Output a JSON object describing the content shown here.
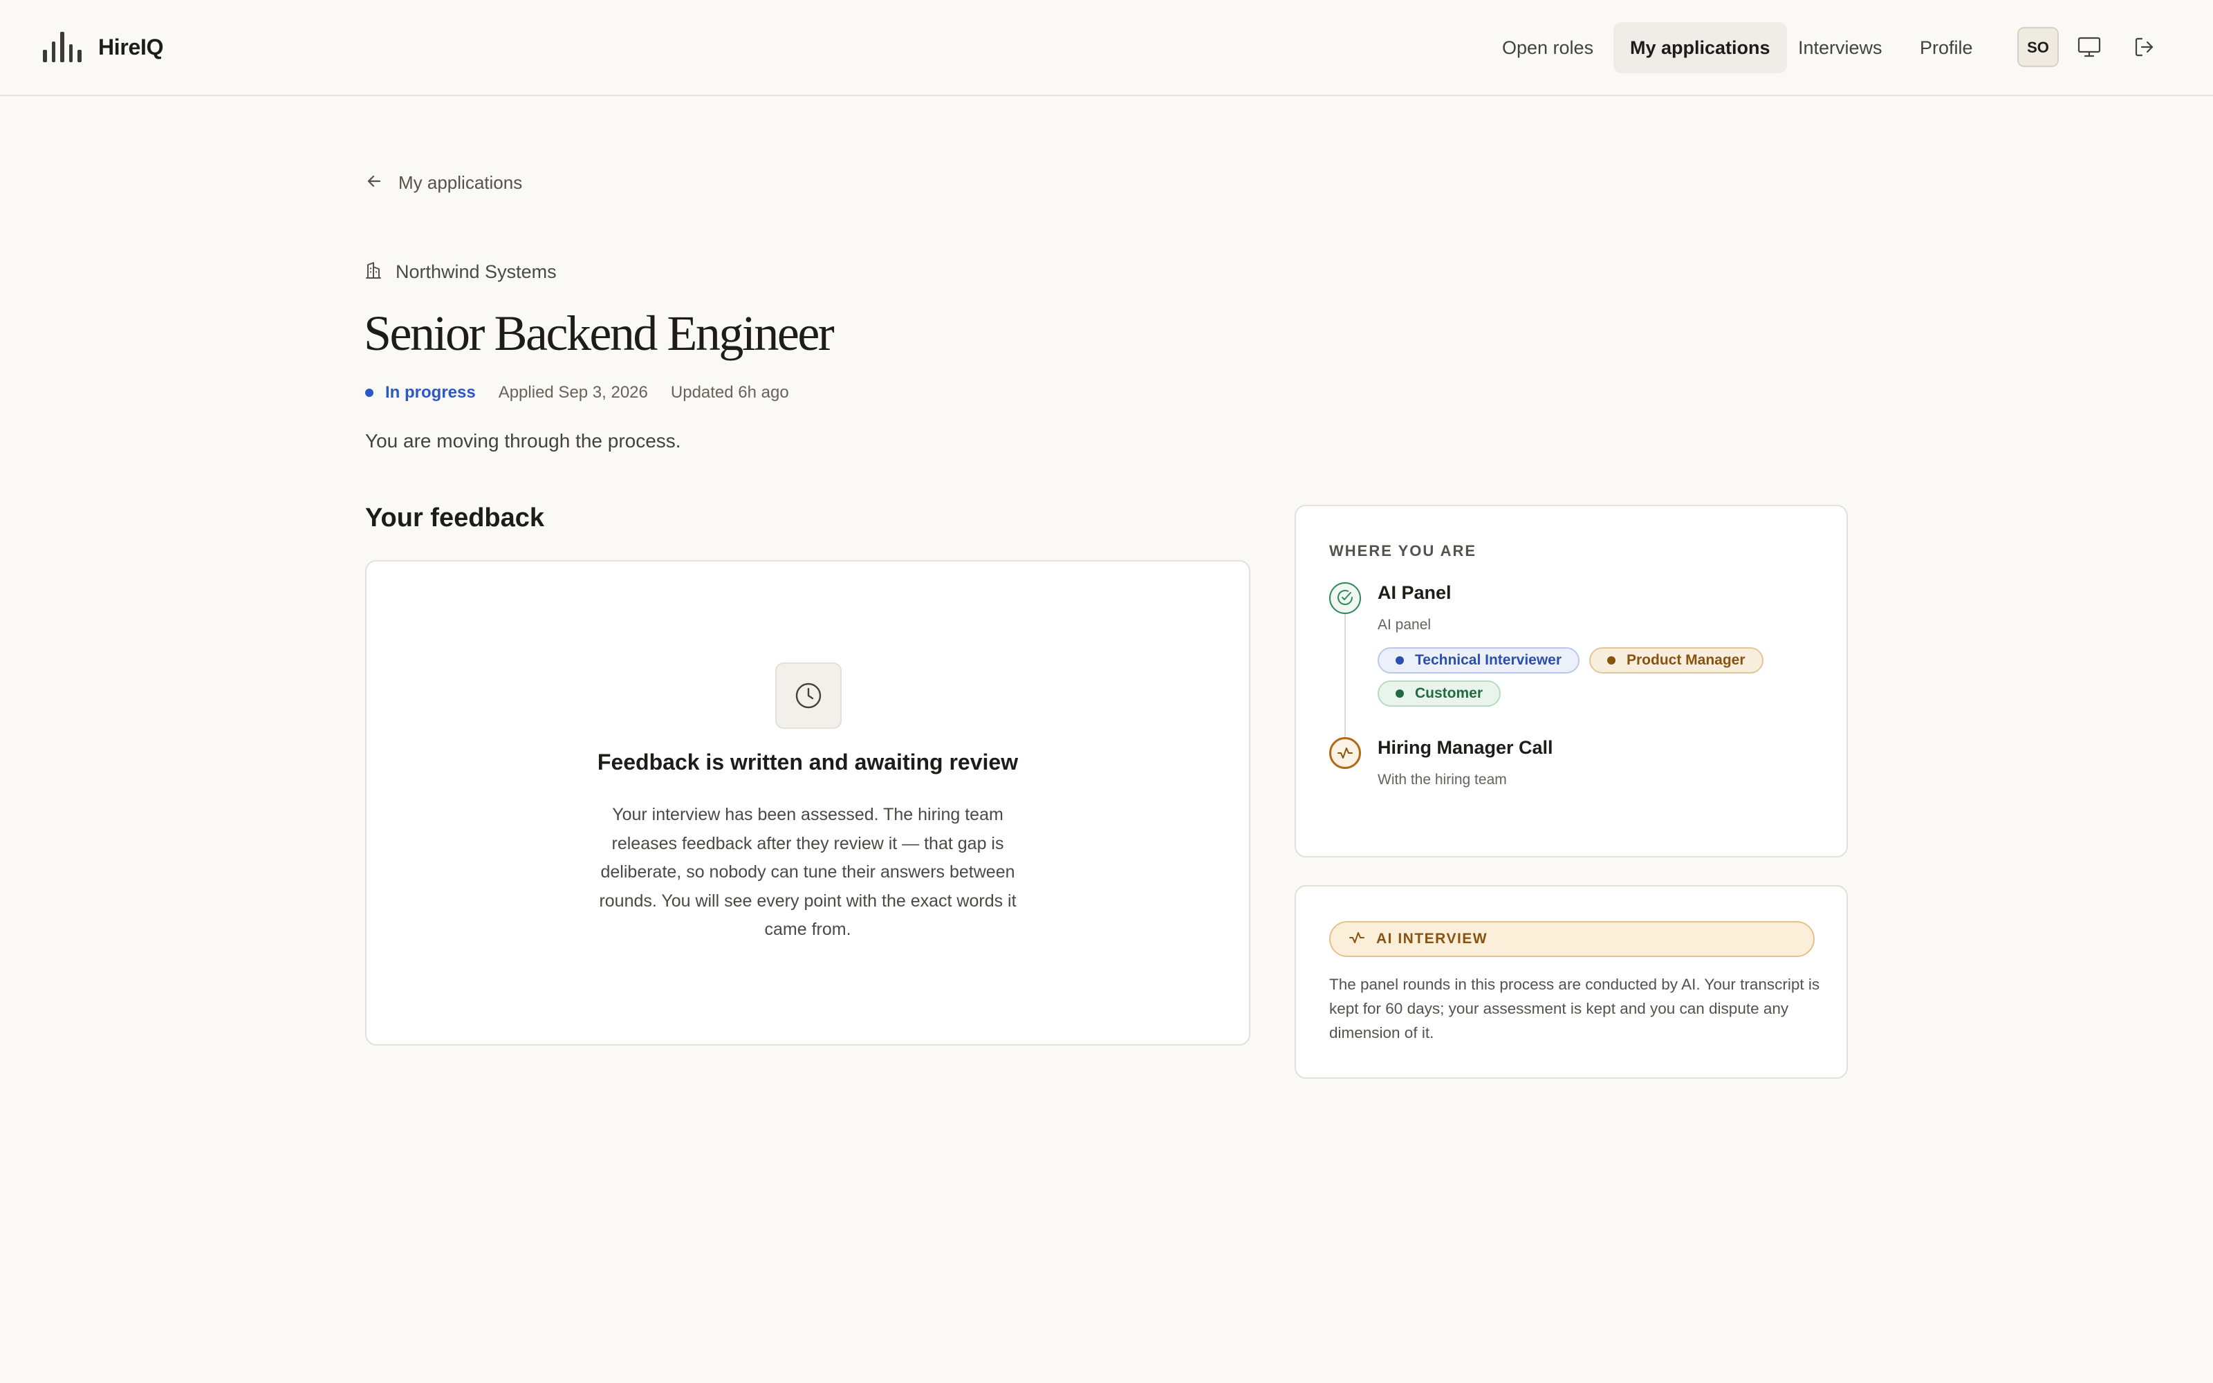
{
  "app": {
    "name": "HireIQ"
  },
  "nav": {
    "items": [
      {
        "label": "Open roles"
      },
      {
        "label": "My applications",
        "active": true
      },
      {
        "label": "Interviews"
      },
      {
        "label": "Profile"
      }
    ],
    "avatar_initials": "SO",
    "monitor_icon": "monitor-icon",
    "logout_icon": "logout-icon"
  },
  "back": {
    "label": "My applications",
    "icon": "arrow-left-icon"
  },
  "job": {
    "company": "Northwind Systems",
    "company_icon": "building-icon",
    "title": "Senior Backend Engineer",
    "status": "In progress",
    "status_color": "#2a58c9",
    "applied": "Applied Sep 3, 2026",
    "updated": "Updated 6h ago",
    "subtitle": "You are moving through the process."
  },
  "feedback": {
    "section_title": "Your feedback",
    "icon": "clock-icon",
    "heading": "Feedback is written and awaiting review",
    "body": "Your interview has been assessed. The hiring team releases feedback after they review it — that gap is deliberate, so nobody can tune their answers between rounds. You will see every point with the exact words it came from."
  },
  "where": {
    "label": "WHERE YOU ARE",
    "steps": [
      {
        "title": "AI Panel",
        "subtitle": "AI panel",
        "state": "done",
        "icon": "check-circle-icon",
        "chips": [
          "Technical Interviewer",
          "Product Manager",
          "Customer"
        ]
      },
      {
        "title": "Hiring Manager Call",
        "subtitle": "With the hiring team",
        "state": "current",
        "icon": "activity-icon"
      }
    ]
  },
  "ai_interview": {
    "badge": "AI INTERVIEW",
    "icon": "activity-icon",
    "body": "The panel rounds in this process are conducted by AI. Your transcript is kept for 60 days; your assessment is kept and you can dispute any dimension of it."
  },
  "colors": {
    "background": "#faf9f6",
    "accent_blue": "#2a58c9",
    "success_green": "#2f8a5a",
    "amber": "#b06a18"
  }
}
